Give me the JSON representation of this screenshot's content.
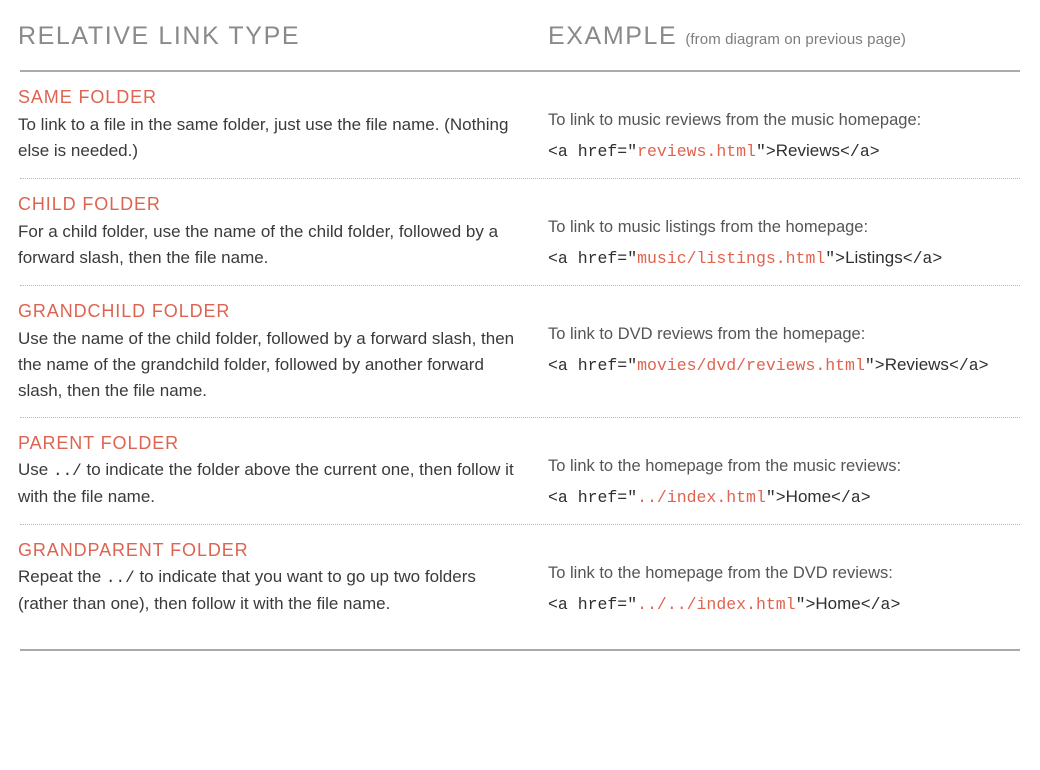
{
  "header": {
    "left_title": "RELATIVE LINK TYPE",
    "right_title": "EXAMPLE",
    "right_note": "(from diagram on previous page)"
  },
  "colors": {
    "accent": "#dd6450",
    "heading_gray": "#8a8a8a",
    "body": "#3a3a3a",
    "rule": "#aaaaaa",
    "dotted_rule": "#b8b8b8"
  },
  "rows": [
    {
      "title": "SAME FOLDER",
      "description_parts": [
        {
          "type": "text",
          "value": "To link to a file in the same folder, just use the file name. (Nothing else is needed.)"
        }
      ],
      "description_plain": "To link to a file in the same folder, just use the file name. (Nothing else is needed.)",
      "example_lead": "To link to music reviews from the music homepage:",
      "code_parts": [
        {
          "type": "code",
          "value": "<a href=\""
        },
        {
          "type": "attr",
          "value": "reviews.html"
        },
        {
          "type": "code",
          "value": "\">"
        },
        {
          "type": "linktext",
          "value": "Reviews"
        },
        {
          "type": "code",
          "value": "</a>"
        }
      ]
    },
    {
      "title": "CHILD FOLDER",
      "description_parts": [
        {
          "type": "text",
          "value": "For a child folder, use the name of the child folder, followed by a forward slash, then the file name."
        }
      ],
      "description_plain": "For a child folder, use the name of the child folder, followed by a forward slash, then the file name.",
      "example_lead": "To link to music listings from the homepage:",
      "code_parts": [
        {
          "type": "code",
          "value": "<a href=\""
        },
        {
          "type": "attr",
          "value": "music/listings.html"
        },
        {
          "type": "code",
          "value": "\">"
        },
        {
          "type": "linktext",
          "value": "Listings"
        },
        {
          "type": "code",
          "value": "</a>"
        }
      ]
    },
    {
      "title": "GRANDCHILD FOLDER",
      "description_parts": [
        {
          "type": "text",
          "value": "Use the name of the child folder, followed by a forward slash, then the name of the grandchild folder, followed by another forward slash, then the file name."
        }
      ],
      "description_plain": "Use the name of the child folder, followed by a forward slash, then the name of the grandchild folder, followed by another forward slash, then the file name.",
      "example_lead": "To link to DVD reviews from the homepage:",
      "code_parts": [
        {
          "type": "code",
          "value": "<a href=\""
        },
        {
          "type": "attr",
          "value": "movies/dvd/reviews.html"
        },
        {
          "type": "code",
          "value": "\">"
        },
        {
          "type": "linktext",
          "value": "Reviews"
        },
        {
          "type": "code",
          "value": "</a>"
        }
      ]
    },
    {
      "title": "PARENT FOLDER",
      "description_parts": [
        {
          "type": "text",
          "value": "Use "
        },
        {
          "type": "mono",
          "value": "../"
        },
        {
          "type": "text",
          "value": " to indicate the folder above the current one, then follow it with the file name."
        }
      ],
      "description_plain": "Use ../ to indicate the folder above the current one, then follow it with the file name.",
      "example_lead": "To link to the homepage from the music reviews:",
      "code_parts": [
        {
          "type": "code",
          "value": "<a href=\""
        },
        {
          "type": "attr",
          "value": "../index.html"
        },
        {
          "type": "code",
          "value": "\">"
        },
        {
          "type": "linktext",
          "value": "Home"
        },
        {
          "type": "code",
          "value": "</a>"
        }
      ]
    },
    {
      "title": "GRANDPARENT FOLDER",
      "description_parts": [
        {
          "type": "text",
          "value": "Repeat the "
        },
        {
          "type": "mono",
          "value": "../"
        },
        {
          "type": "text",
          "value": " to indicate that you want to go up two folders (rather than one), then follow it with the file name."
        }
      ],
      "description_plain": "Repeat the ../ to indicate that you want to go up two folders (rather than one), then follow it with the file name.",
      "example_lead": "To link to the homepage from the DVD reviews:",
      "code_parts": [
        {
          "type": "code",
          "value": "<a href=\""
        },
        {
          "type": "attr",
          "value": "../../index.html"
        },
        {
          "type": "code",
          "value": "\">"
        },
        {
          "type": "linktext",
          "value": "Home"
        },
        {
          "type": "code",
          "value": "</a>"
        }
      ]
    }
  ]
}
